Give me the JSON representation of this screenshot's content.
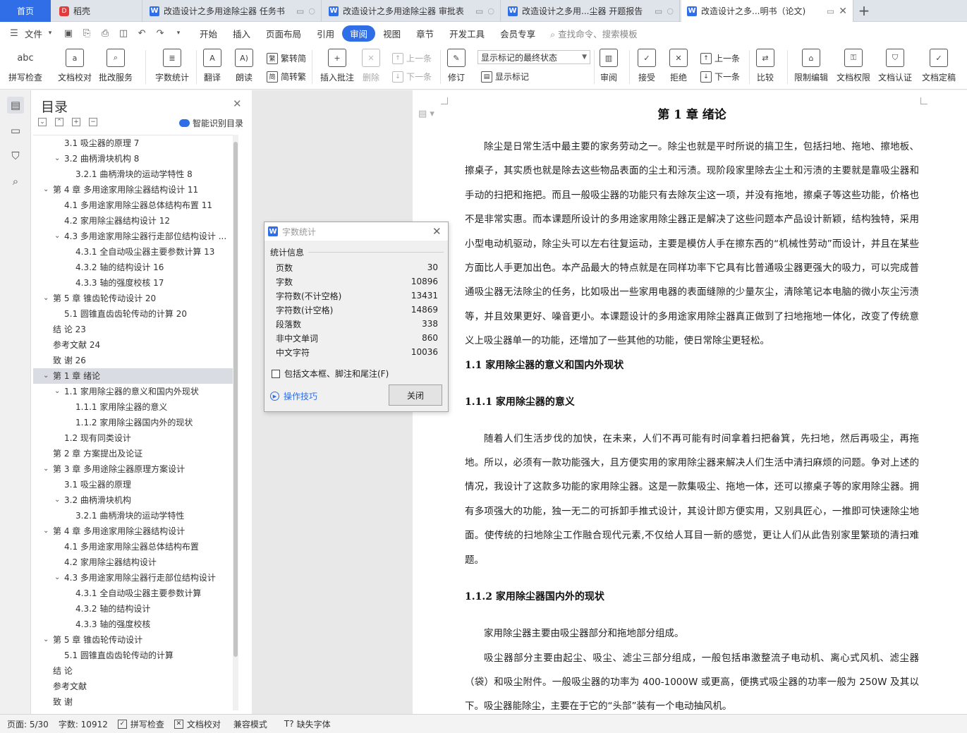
{
  "tabs": {
    "home": "首页",
    "items": [
      {
        "label": "稻壳",
        "icon": "daoke-icon"
      },
      {
        "label": "改造设计之多用途除尘器 任务书",
        "icon": "wps-writer-icon"
      },
      {
        "label": "改造设计之多用途除尘器 审批表",
        "icon": "wps-writer-icon"
      },
      {
        "label": "改造设计之多用...尘器 开题报告",
        "icon": "wps-writer-icon"
      },
      {
        "label": "改造设计之多...明书（论文)",
        "icon": "wps-writer-icon"
      }
    ],
    "new_tab": "+"
  },
  "menu": {
    "file": "文件",
    "items": [
      "开始",
      "插入",
      "页面布局",
      "引用",
      "审阅",
      "视图",
      "章节",
      "开发工具",
      "会员专享"
    ],
    "active": "审阅",
    "search": "查找命令、搜索模板"
  },
  "ribbon": {
    "spellcheck": "拼写检查",
    "proofread": "文档校对",
    "review_service": "批改服务",
    "word_count": "字数统计",
    "translate": "翻译",
    "read_aloud": "朗读",
    "to_traditional": "繁转简",
    "to_simplified": "简转繁",
    "insert_comment": "插入批注",
    "delete": "删除",
    "prev_comment": "上一条",
    "next_comment": "下一条",
    "track_changes": "修订",
    "markup_state": "显示标记的最终状态",
    "show_markup": "显示标记",
    "review_pane": "审阅",
    "accept": "接受",
    "reject": "拒绝",
    "prev_change": "上一条",
    "next_change": "下一条",
    "compare": "比较",
    "restrict_edit": "限制编辑",
    "doc_permission": "文档权限",
    "doc_certify": "文档认证",
    "doc_finalize": "文档定稿"
  },
  "toc": {
    "title": "目录",
    "smart_toc": "智能识别目录",
    "items": [
      {
        "label": "3.1 吸尘器的原理 7",
        "level": 2,
        "caret": ""
      },
      {
        "label": "3.2 曲柄滑块机构 8",
        "level": 2,
        "caret": "v"
      },
      {
        "label": "3.2.1 曲柄滑块的运动学特性 8",
        "level": 3,
        "caret": ""
      },
      {
        "label": "第 4 章  多用途家用除尘器结构设计 11",
        "level": 1,
        "caret": "v"
      },
      {
        "label": "4.1  多用途家用除尘器总体结构布置 11",
        "level": 2,
        "caret": ""
      },
      {
        "label": "4.2 家用除尘器结构设计 12",
        "level": 2,
        "caret": ""
      },
      {
        "label": "4.3 多用途家用除尘器行走部位结构设计  ...",
        "level": 2,
        "caret": "v"
      },
      {
        "label": "4.3.1 全自动吸尘器主要参数计算 13",
        "level": 3,
        "caret": ""
      },
      {
        "label": "4.3.2 轴的结构设计 16",
        "level": 3,
        "caret": ""
      },
      {
        "label": "4.3.3 轴的强度校核 17",
        "level": 3,
        "caret": ""
      },
      {
        "label": "第 5 章  锥齿轮传动设计 20",
        "level": 1,
        "caret": "v"
      },
      {
        "label": "5.1 圆锥直齿齿轮传动的计算 20",
        "level": 2,
        "caret": ""
      },
      {
        "label": "结    论 23",
        "level": 1,
        "caret": ""
      },
      {
        "label": "参考文献 24",
        "level": 1,
        "caret": ""
      },
      {
        "label": "致    谢 26",
        "level": 1,
        "caret": ""
      },
      {
        "label": "第 1 章  绪论",
        "level": 1,
        "caret": "v",
        "selected": true
      },
      {
        "label": "1.1 家用除尘器的意义和国内外现状",
        "level": 2,
        "caret": "v"
      },
      {
        "label": "1.1.1 家用除尘器的意义",
        "level": 3,
        "caret": ""
      },
      {
        "label": "1.1.2 家用除尘器国内外的现状",
        "level": 3,
        "caret": ""
      },
      {
        "label": "1.2 现有同类设计",
        "level": 2,
        "caret": ""
      },
      {
        "label": "第 2 章  方案提出及论证",
        "level": 1,
        "caret": ""
      },
      {
        "label": "第 3 章  多用途除尘器原理方案设计",
        "level": 1,
        "caret": "v"
      },
      {
        "label": "3.1 吸尘器的原理",
        "level": 2,
        "caret": ""
      },
      {
        "label": "3.2  曲柄滑块机构",
        "level": 2,
        "caret": "v"
      },
      {
        "label": "3.2.1 曲柄滑块的运动学特性",
        "level": 3,
        "caret": ""
      },
      {
        "label": "第 4 章  多用途家用除尘器结构设计",
        "level": 1,
        "caret": "v"
      },
      {
        "label": "4.1  多用途家用除尘器总体结构布置",
        "level": 2,
        "caret": ""
      },
      {
        "label": "4.2 家用除尘器结构设计",
        "level": 2,
        "caret": ""
      },
      {
        "label": "4.3 多用途家用除尘器行走部位结构设计",
        "level": 2,
        "caret": "v"
      },
      {
        "label": "4.3.1 全自动吸尘器主要参数计算",
        "level": 3,
        "caret": ""
      },
      {
        "label": "4.3.2 轴的结构设计",
        "level": 3,
        "caret": ""
      },
      {
        "label": "4.3.3 轴的强度校核",
        "level": 3,
        "caret": ""
      },
      {
        "label": "第 5 章  锥齿轮传动设计",
        "level": 1,
        "caret": "v"
      },
      {
        "label": "5.1 圆锥直齿齿轮传动的计算",
        "level": 2,
        "caret": ""
      },
      {
        "label": "结    论",
        "level": 1,
        "caret": ""
      },
      {
        "label": "参考文献",
        "level": 1,
        "caret": ""
      },
      {
        "label": "致    谢",
        "level": 1,
        "caret": ""
      }
    ]
  },
  "document": {
    "chapter_title": "第 1 章  绪论",
    "p1": "除尘是日常生活中最主要的家务劳动之一。除尘也就是平时所说的搞卫生，包括扫地、拖地、擦地板、擦桌子，其实质也就是除去这些物品表面的尘土和污渍。现阶段家里除去尘土和污渍的主要就是靠吸尘器和手动的扫把和拖把。而且一般吸尘器的功能只有去除灰尘这一项，并没有拖地，擦桌子等这些功能，价格也不是非常实惠。而本课题所设计的多用途家用除尘器正是解决了这些问题本产品设计新颖，结构独特，采用小型电动机驱动，除尘头可以左右往复运动，主要是模仿人手在擦东西的“机械性劳动”而设计，并且在某些方面比人手更加出色。本产品最大的特点就是在同样功率下它具有比普通吸尘器更强大的吸力，可以完成普通吸尘器无法除尘的任务，比如吸出一些家用电器的表面缝隙的少量灰尘，清除笔记本电脑的微小灰尘污渍等，并且效果更好、噪音更小。本课题设计的多用途家用除尘器真正做到了扫地拖地一体化，改变了传统意义上吸尘器单一的功能，还增加了一些其他的功能，使日常除尘更轻松。",
    "h_1_1": "1.1 家用除尘器的意义和国内外现状",
    "h_1_1_1": "1.1.1 家用除尘器的意义",
    "p2": "随着人们生活步伐的加快，在未来，人们不再可能有时间拿着扫把畚箕，先扫地，然后再吸尘，再拖地。所以，必须有一款功能强大，且方便实用的家用除尘器来解决人们生活中清扫麻烦的问题。争对上述的情况，我设计了这款多功能的家用除尘器。这是一款集吸尘、拖地一体，还可以擦桌子等的家用除尘器。拥有多项强大的功能，独一无二的可拆卸手推式设计，其设计即方便实用，又别具匠心，一推即可快速除尘地面。使传统的扫地除尘工作融合现代元素,不仅给人耳目一新的感觉，更让人们从此告别家里繁琐的清扫难题。",
    "h_1_1_2": "1.1.2 家用除尘器国内外的现状",
    "p3": "家用除尘器主要由吸尘器部分和拖地部分组成。",
    "p4": "吸尘器部分主要由起尘、吸尘、滤尘三部分组成，一般包括串激整流子电动机、离心式风机、滤尘器（袋）和吸尘附件。一般吸尘器的功率为 400-1000W 或更高，便携式吸尘器的功率一般为 250W 及其以下。吸尘器能除尘，主要在于它的“头部”装有一个电动抽风机。"
  },
  "dialog": {
    "title": "字数统计",
    "section": "统计信息",
    "rows": [
      {
        "label": "页数",
        "value": "30"
      },
      {
        "label": "字数",
        "value": "10896"
      },
      {
        "label": "字符数(不计空格)",
        "value": "13431"
      },
      {
        "label": "字符数(计空格)",
        "value": "14869"
      },
      {
        "label": "段落数",
        "value": "338"
      },
      {
        "label": "非中文单词",
        "value": "860"
      },
      {
        "label": "中文字符",
        "value": "10036"
      }
    ],
    "checkbox": "包括文本框、脚注和尾注(F)",
    "tip": "操作技巧",
    "close": "关闭"
  },
  "status": {
    "page": "页面: 5/30",
    "words": "字数: 10912",
    "spellcheck": "拼写检查",
    "proofread": "文档校对",
    "compat": "兼容模式",
    "missing_font": "缺失字体"
  },
  "colors": {
    "accent": "#2f6ee6",
    "selected_toc": "#d9dde3",
    "workspace": "#e8e8e8"
  }
}
